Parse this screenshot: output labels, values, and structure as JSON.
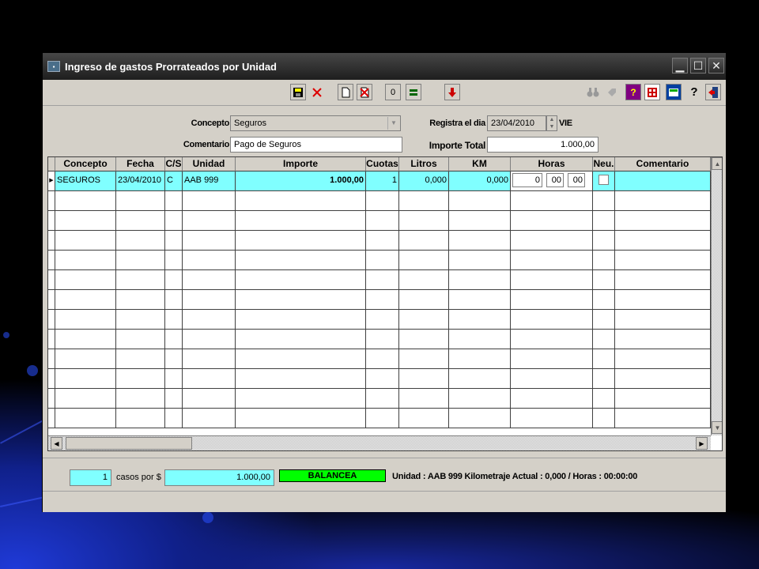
{
  "window": {
    "title": "Ingreso de gastos Prorrateados por Unidad"
  },
  "toolbar": {
    "counter": "0"
  },
  "form": {
    "concepto_label": "Concepto",
    "concepto_value": "Seguros",
    "comentario_label": "Comentario",
    "comentario_value": "Pago de Seguros",
    "registra_label": "Registra el dia",
    "registra_value": "23/04/2010",
    "day": "VIE",
    "importe_total_label": "Importe Total",
    "importe_total_value": "1.000,00"
  },
  "grid": {
    "columns": [
      "Concepto",
      "Fecha",
      "C/S",
      "Unidad",
      "Importe",
      "Cuotas",
      "Litros",
      "KM",
      "Horas",
      "Neu.",
      "Comentario"
    ],
    "row1": {
      "concepto": "SEGUROS",
      "fecha": "23/04/2010",
      "cs": "C",
      "unidad": "AAB 999",
      "importe": "1.000,00",
      "cuotas": "1",
      "litros": "0,000",
      "km": "0,000",
      "horas_h": "0",
      "horas_m": "00",
      "horas_s": "00"
    }
  },
  "status": {
    "casos": "1",
    "casos_label": "casos por $",
    "total": "1.000,00",
    "balance": "BALANCEA",
    "info": "Unidad : AAB 999 Kilometraje Actual : 0,000 / Horas : 00:00:00"
  },
  "colors": {
    "highlight": "#80ffff",
    "balance": "#00ff00"
  }
}
